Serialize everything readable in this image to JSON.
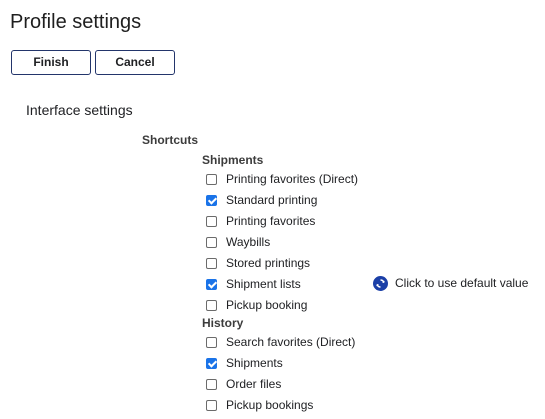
{
  "header": {
    "title": "Profile settings"
  },
  "toolbar": {
    "finish_label": "Finish",
    "cancel_label": "Cancel"
  },
  "interface": {
    "title": "Interface settings",
    "shortcuts_label": "Shortcuts",
    "shipments": {
      "label": "Shipments",
      "items": [
        {
          "label": "Printing favorites (Direct)",
          "checked": false
        },
        {
          "label": "Standard printing",
          "checked": true
        },
        {
          "label": "Printing favorites",
          "checked": false
        },
        {
          "label": "Waybills",
          "checked": false
        },
        {
          "label": "Stored printings",
          "checked": false
        },
        {
          "label": "Shipment lists",
          "checked": true
        },
        {
          "label": "Pickup booking",
          "checked": false
        }
      ]
    },
    "history": {
      "label": "History",
      "items": [
        {
          "label": "Search favorites (Direct)",
          "checked": false
        },
        {
          "label": "Shipments",
          "checked": true
        },
        {
          "label": "Order files",
          "checked": false
        },
        {
          "label": "Pickup bookings",
          "checked": false
        }
      ]
    },
    "default_link": {
      "icon": "reset-default-icon",
      "label": "Click to use default value"
    }
  },
  "colors": {
    "accent": "#1a73e8",
    "button_border": "#23356b",
    "reset_icon": "#1b3fa7"
  }
}
